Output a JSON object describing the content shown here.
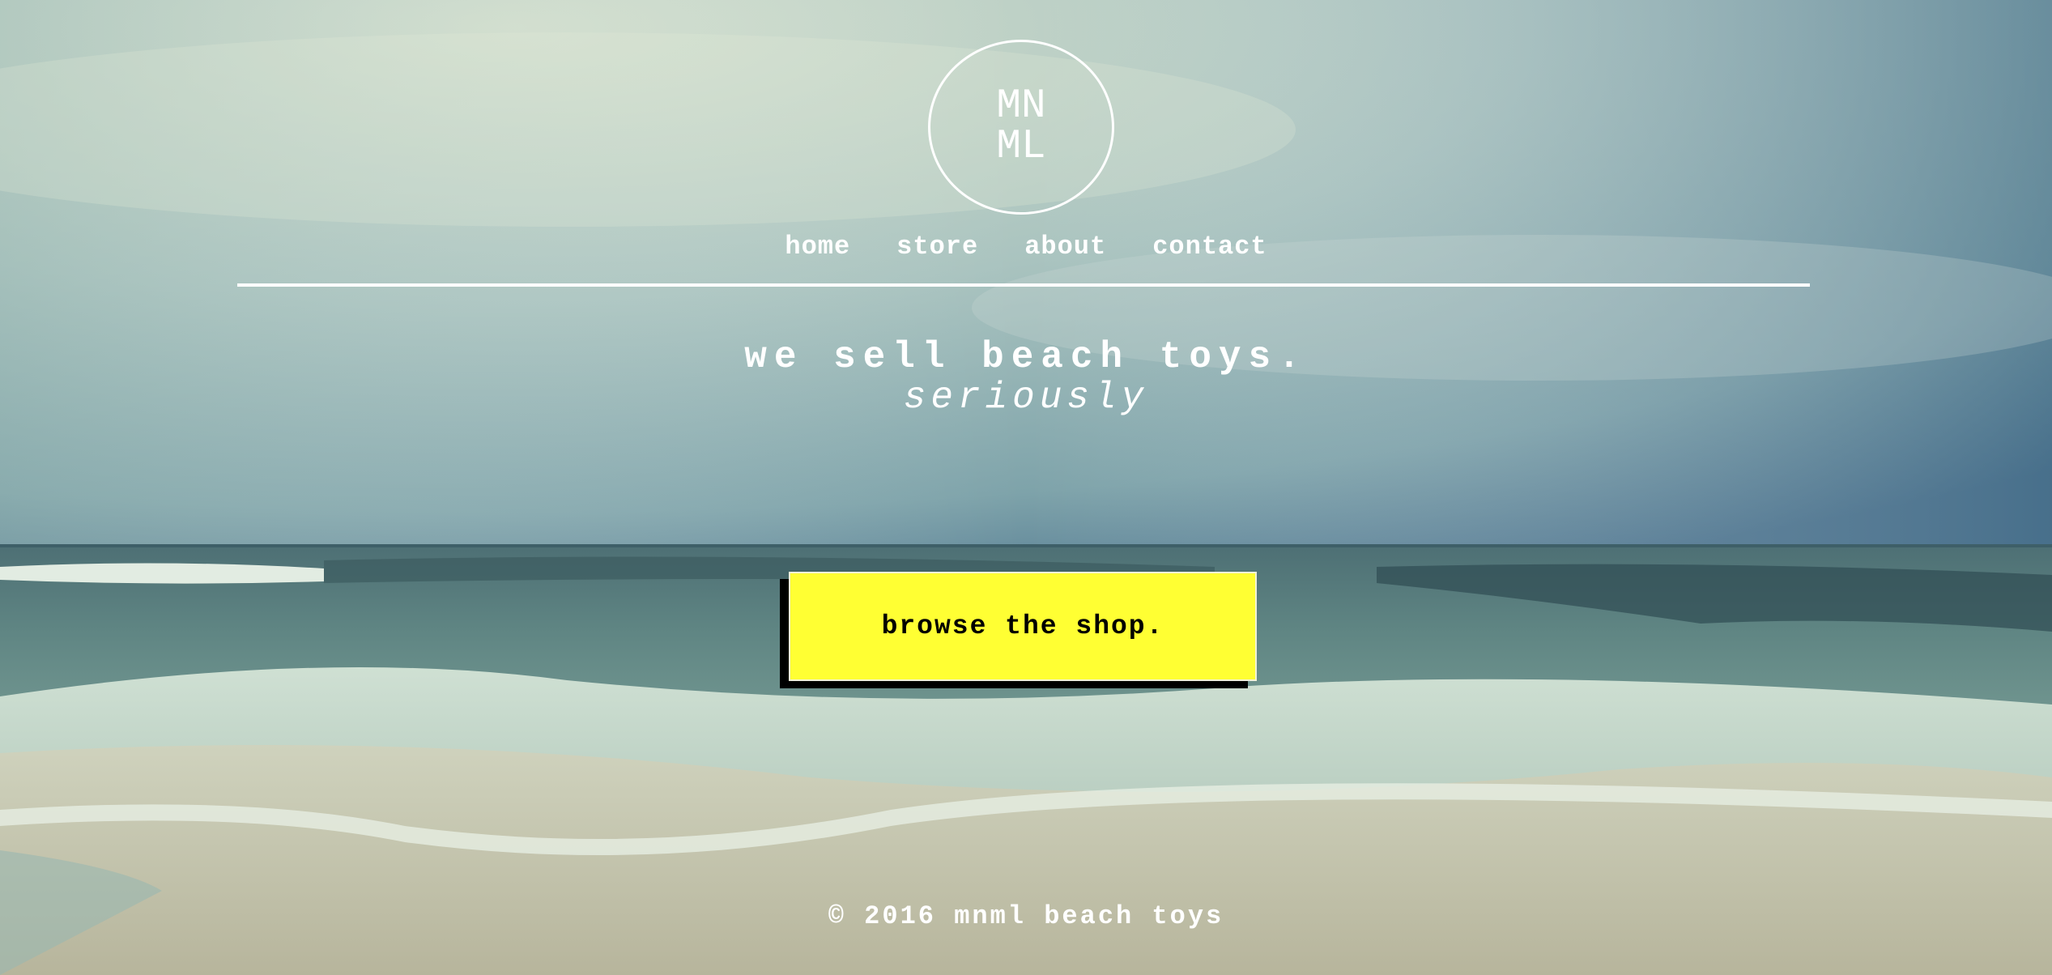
{
  "logo": {
    "line1": "MN",
    "line2": "ML"
  },
  "nav": {
    "items": [
      {
        "label": "home"
      },
      {
        "label": "store"
      },
      {
        "label": "about"
      },
      {
        "label": "contact"
      }
    ]
  },
  "hero": {
    "headline": "we sell beach toys.",
    "tagline": "seriously",
    "cta_label": "browse the shop."
  },
  "footer": {
    "text": "© 2016 mnml beach toys"
  },
  "colors": {
    "cta_background": "#ffff33",
    "cta_shadow": "#000000",
    "text": "#ffffff"
  }
}
